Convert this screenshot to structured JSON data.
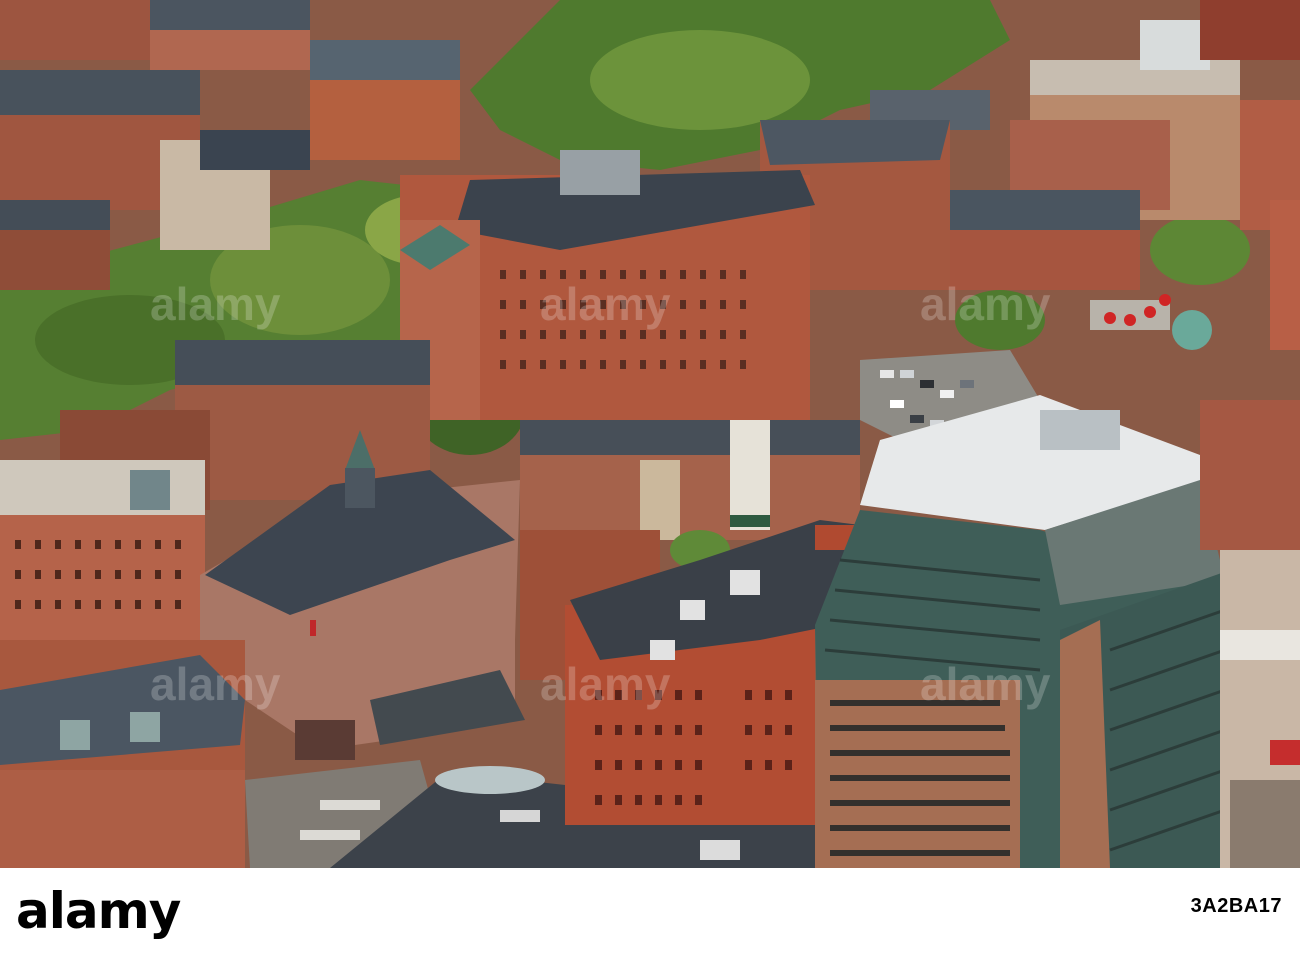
{
  "photo": {
    "subject": "Aerial view of city blocks with brick buildings, trees and a glass office tower",
    "palette": {
      "brick": "#a55a43",
      "brick_dark": "#7a3f2f",
      "roof_slate": "#3c4450",
      "roof_light": "#d9dcde",
      "tree": "#4f7a2e",
      "tree_light": "#7f9e3f",
      "glass": "#3c5a55",
      "street": "#8e8c86"
    }
  },
  "watermark": {
    "brand": "alamy",
    "overlay": "alamy"
  },
  "footer": {
    "logo_text": "alamy",
    "image_id": "3A2BA17"
  }
}
